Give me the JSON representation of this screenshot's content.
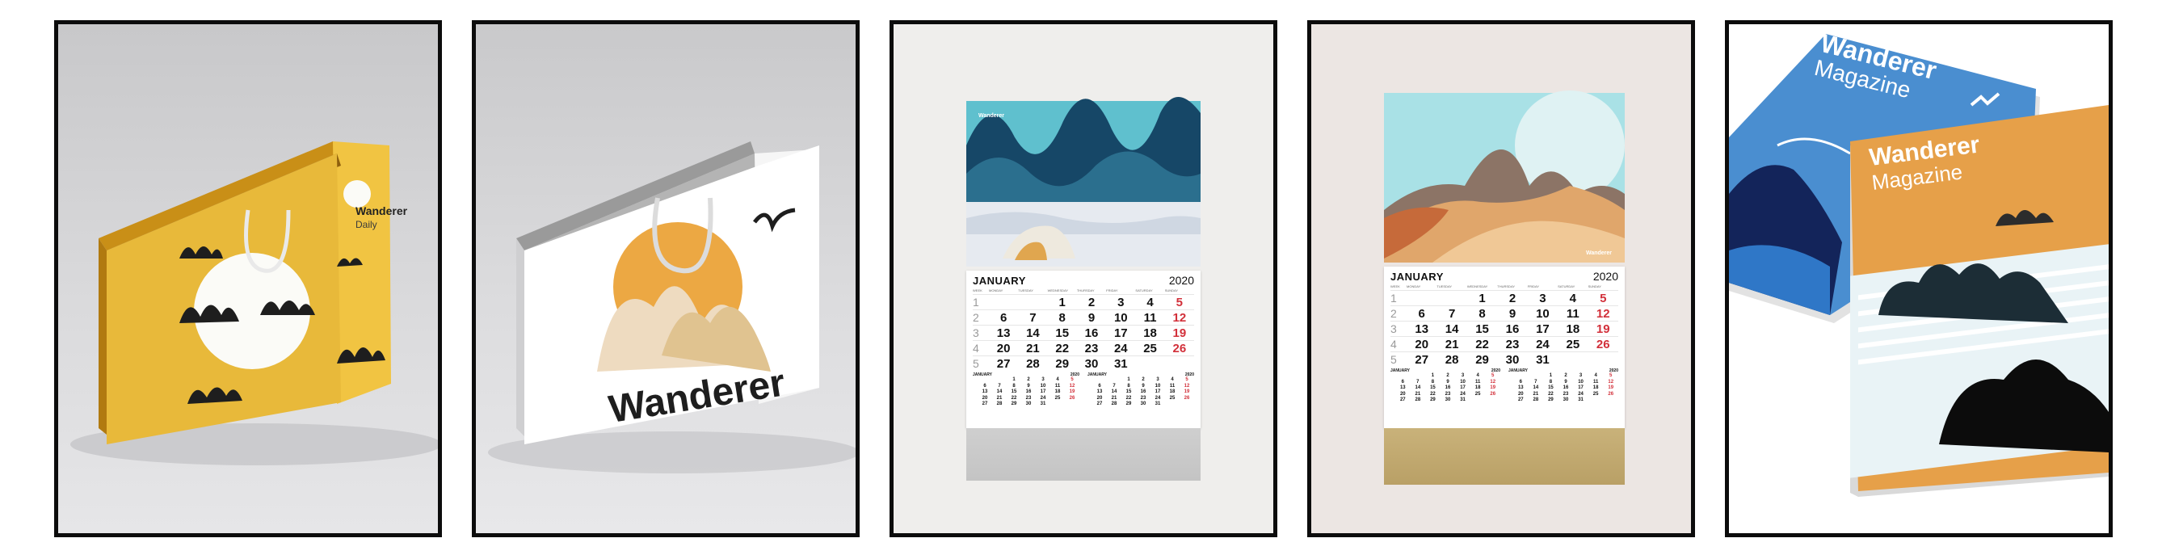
{
  "panels": {
    "p1": {
      "brand": "Wanderer",
      "sub": "Daily"
    },
    "p2": {
      "brand": "Wanderer"
    },
    "p3": {
      "calendar_brand": "Wanderer"
    },
    "p4": {
      "calendar_brand": "Wanderer"
    },
    "p5": {
      "back_title": "Wanderer",
      "back_sub": "Magazine",
      "front_title": "Wanderer",
      "front_sub": "Magazine"
    }
  },
  "calendar": {
    "month": "JANUARY",
    "year": "2020",
    "weekdays": [
      "WEEK",
      "MONDAY",
      "TUESDAY",
      "WEDNESDAY",
      "THURSDAY",
      "FRIDAY",
      "SATURDAY",
      "SUNDAY"
    ],
    "rows": [
      [
        "1",
        "",
        "",
        "",
        "1",
        "2",
        "3",
        "4",
        "5"
      ],
      [
        "2",
        "6",
        "7",
        "8",
        "9",
        "10",
        "11",
        "12"
      ],
      [
        "3",
        "13",
        "14",
        "15",
        "16",
        "17",
        "18",
        "19"
      ],
      [
        "4",
        "20",
        "21",
        "22",
        "23",
        "24",
        "25",
        "26"
      ],
      [
        "5",
        "27",
        "28",
        "29",
        "30",
        "31",
        "",
        ""
      ]
    ],
    "mini": [
      {
        "month": "JANUARY",
        "year": "2020"
      },
      {
        "month": "JANUARY",
        "year": "2020"
      }
    ],
    "mini_rows": [
      [
        "",
        "",
        "",
        "1",
        "2",
        "3",
        "4",
        "5"
      ],
      [
        "",
        "6",
        "7",
        "8",
        "9",
        "10",
        "11",
        "12"
      ],
      [
        "",
        "13",
        "14",
        "15",
        "16",
        "17",
        "18",
        "19"
      ],
      [
        "",
        "20",
        "21",
        "22",
        "23",
        "24",
        "25",
        "26"
      ],
      [
        "",
        "27",
        "28",
        "29",
        "30",
        "31",
        "",
        ""
      ]
    ]
  },
  "colors": {
    "frame": "#0c0c0c",
    "bag_yellow": "#e8b93a",
    "ink": "#1e1e1e",
    "sun_orange": "#eca843",
    "sunday_red": "#d2303a",
    "mag_blue": "#4a8ed0",
    "mag_orange": "#e6a049"
  }
}
